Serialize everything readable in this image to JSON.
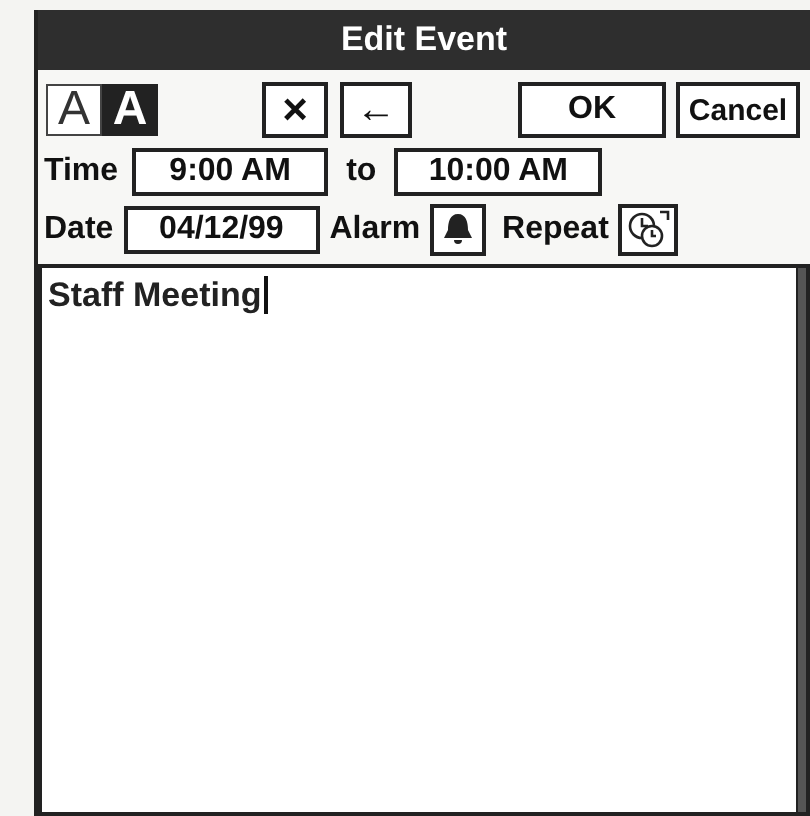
{
  "window": {
    "title": "Edit Event"
  },
  "font_styles": [
    {
      "label": "A",
      "selected": false
    },
    {
      "label": "A",
      "selected": true
    }
  ],
  "toolbar": {
    "delete": "×",
    "backspace": "←",
    "ok": "OK",
    "cancel": "Cancel"
  },
  "time": {
    "label": "Time",
    "start": "9:00 AM",
    "separator": "to",
    "end": "10:00 AM"
  },
  "date": {
    "label": "Date",
    "value": "04/12/99",
    "alarm_label": "Alarm",
    "repeat_label": "Repeat"
  },
  "note": {
    "value": "Staff Meeting"
  }
}
